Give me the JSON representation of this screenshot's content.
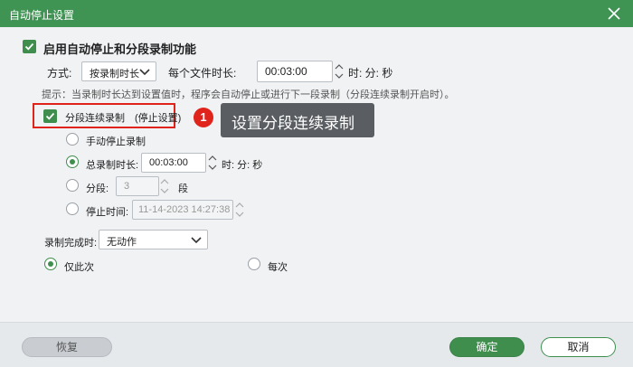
{
  "window": {
    "title": "自动停止设置"
  },
  "main": {
    "enable_label": "启用自动停止和分段录制功能",
    "mode_label": "方式:",
    "mode_value": "按录制时长",
    "file_duration_label": "每个文件时长:",
    "file_duration_value": "00:03:00",
    "file_duration_unit": "时: 分: 秒",
    "hint": "提示：当录制时长达到设置值时，程序会自动停止或进行下一段录制（分段连续录制开启时）。",
    "segment_label": "分段连续录制　(停止设置)",
    "options": {
      "manual_stop": "手动停止录制",
      "total_duration_label": "总录制时长:",
      "total_duration_value": "00:03:00",
      "total_duration_unit": "时: 分: 秒",
      "segments_label": "分段:",
      "segments_value": "3",
      "segments_unit": "段",
      "stop_time_label": "停止时间:",
      "stop_time_value": "11-14-2023 14:27:38"
    },
    "on_complete_label": "录制完成时:",
    "on_complete_value": "无动作",
    "only_once_label": "仅此次",
    "every_time_label": "每次"
  },
  "annotation": {
    "badge": "1",
    "callout": "设置分段连续录制",
    "highlight_color": "#e0241c"
  },
  "footer": {
    "reset_label": "恢复",
    "ok_label": "确定",
    "cancel_label": "取消"
  },
  "colors": {
    "accent": "#3f8e4e",
    "titlebar": "#3f9454"
  }
}
